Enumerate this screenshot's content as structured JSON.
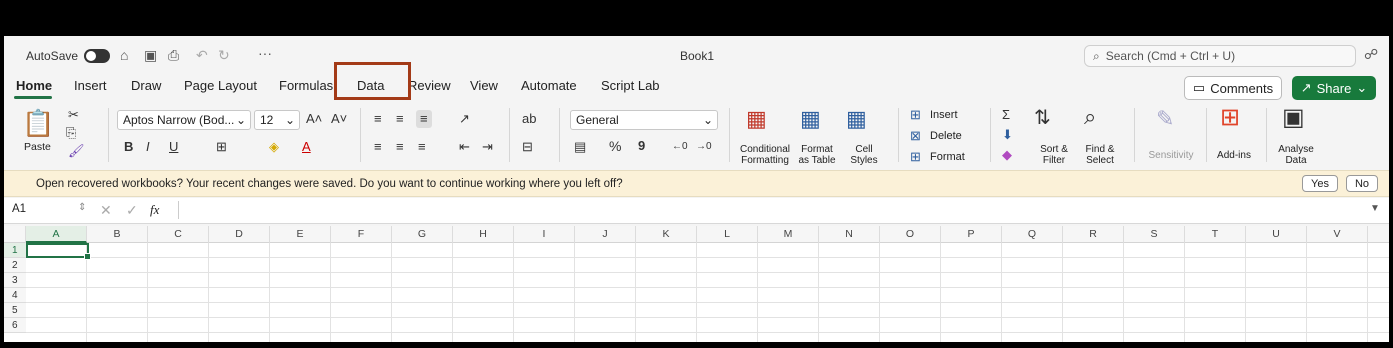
{
  "titlebar": {
    "autosave_label": "AutoSave",
    "more_glyph": "···",
    "book_title": "Book1",
    "search_placeholder": "Search (Cmd + Ctrl + U)"
  },
  "tabs": [
    "Home",
    "Insert",
    "Draw",
    "Page Layout",
    "Formulas",
    "Data",
    "Review",
    "View",
    "Automate",
    "Script Lab"
  ],
  "active_tab": "Home",
  "highlighted_tab": "Data",
  "comments_label": "Comments",
  "share_label": "Share",
  "ribbon": {
    "paste_label": "Paste",
    "font_name": "Aptos Narrow (Bod...",
    "font_size": "12",
    "bold": "B",
    "italic": "I",
    "underline": "U",
    "number_format": "General",
    "percent": "%",
    "comma": "9",
    "cond_fmt_1": "Conditional",
    "cond_fmt_2": "Formatting",
    "fmt_table_1": "Format",
    "fmt_table_2": "as Table",
    "cell_styles_1": "Cell",
    "cell_styles_2": "Styles",
    "insert_label": "Insert",
    "delete_label": "Delete",
    "format_label": "Format",
    "sort_1": "Sort &",
    "sort_2": "Filter",
    "find_1": "Find &",
    "find_2": "Select",
    "sensitivity": "Sensitivity",
    "addins": "Add-ins",
    "analyse_1": "Analyse",
    "analyse_2": "Data"
  },
  "banner": {
    "message": "Open recovered workbooks?  Your recent changes were saved. Do you want to continue working where you left off?",
    "yes": "Yes",
    "no": "No"
  },
  "formula_bar": {
    "name_box": "A1",
    "fx": "fx",
    "value": ""
  },
  "grid": {
    "columns": [
      "A",
      "B",
      "C",
      "D",
      "E",
      "F",
      "G",
      "H",
      "I",
      "J",
      "K",
      "L",
      "M",
      "N",
      "O",
      "P",
      "Q",
      "R",
      "S",
      "T",
      "U",
      "V"
    ],
    "rows": [
      "1",
      "2",
      "3",
      "4",
      "5",
      "6"
    ],
    "active_cell": "A1"
  },
  "colors": {
    "accent_green": "#217346",
    "share_green": "#187a3c",
    "highlight_box": "#a33a17",
    "banner_bg": "#fbf1d8"
  }
}
